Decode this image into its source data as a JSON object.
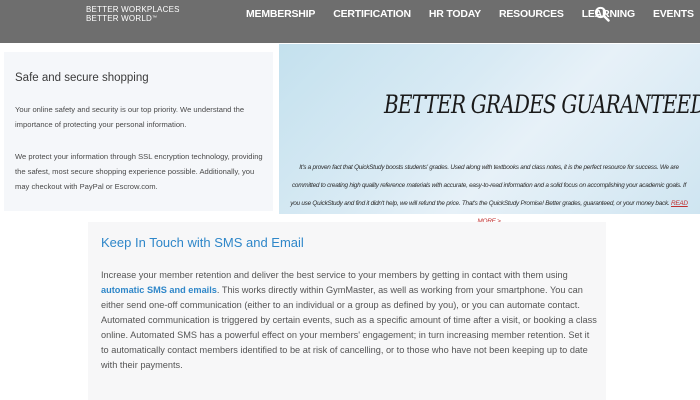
{
  "logo": {
    "line1": "BETTER WORKPLACES",
    "line2": "BETTER WORLD",
    "mark": "™"
  },
  "nav": {
    "items": [
      "MEMBERSHIP",
      "CERTIFICATION",
      "HR TODAY",
      "RESOURCES",
      "LEARNING",
      "EVENTS"
    ],
    "search_icon": "search-icon"
  },
  "info_card": {
    "title": "Safe and secure shopping",
    "p1": "Your online safety and security is our top priority. We understand the importance of protecting your personal information.",
    "p2": "We protect your information through SSL encryption technology, providing the safest, most secure shopping experience possible. Additionally, you may checkout with PayPal or Escrow.com."
  },
  "banner": {
    "heading": "BETTER GRADES GUARANTEED",
    "text": "It's a proven fact that QuickStudy boosts students' grades. Used along with textbooks and class notes, it is the perfect resource for success. We are committed to creating high quality reference materials with accurate, easy-to-read information and a solid focus on accomplishing your academic goals. If you use QuickStudy and find it didn't help, we will refund the price. That's the QuickStudy Promise! Better grades, guaranteed, or your money back.",
    "link": "READ MORE >"
  },
  "sms_card": {
    "title": "Keep In Touch with SMS and Email",
    "body_before": "Increase your member retention and deliver the best service to your members by getting in contact with them using ",
    "link": "automatic SMS and emails",
    "body_after": ". This works directly within GymMaster, as well as working from your smartphone. You can either send one-off communication (either to an individual or a group as defined by you), or you can automate contact. Automated communication is triggered by certain events, such as a specific amount of time after a visit, or booking a class online. Automated SMS has a powerful effect on your members' engagement; in turn increasing member retention. Set it to automatically contact members identified to be at risk of cancelling, or to those who have not been keeping up to date with their payments."
  },
  "colors": {
    "nav_bg": "#6e6e6e",
    "link_blue": "#2f87c9",
    "link_red": "#c0302f",
    "card_bg": "#f5f7fa"
  }
}
